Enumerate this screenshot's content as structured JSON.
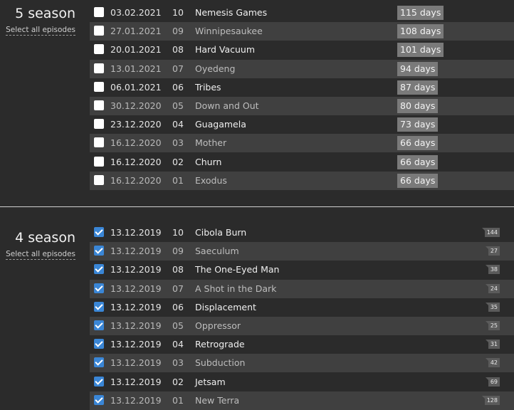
{
  "seasons": [
    {
      "title": "5 season",
      "select_all_label": "Select all episodes",
      "episodes": [
        {
          "checked": false,
          "date": "03.02.2021",
          "num": "10",
          "title": "Nemesis Games",
          "days": "115 days"
        },
        {
          "checked": false,
          "date": "27.01.2021",
          "num": "09",
          "title": "Winnipesaukee",
          "days": "108 days"
        },
        {
          "checked": false,
          "date": "20.01.2021",
          "num": "08",
          "title": "Hard Vacuum",
          "days": "101 days"
        },
        {
          "checked": false,
          "date": "13.01.2021",
          "num": "07",
          "title": "Oyedeng",
          "days": "94 days"
        },
        {
          "checked": false,
          "date": "06.01.2021",
          "num": "06",
          "title": "Tribes",
          "days": "87 days"
        },
        {
          "checked": false,
          "date": "30.12.2020",
          "num": "05",
          "title": "Down and Out",
          "days": "80 days"
        },
        {
          "checked": false,
          "date": "23.12.2020",
          "num": "04",
          "title": "Guagamela",
          "days": "73 days"
        },
        {
          "checked": false,
          "date": "16.12.2020",
          "num": "03",
          "title": "Mother",
          "days": "66 days"
        },
        {
          "checked": false,
          "date": "16.12.2020",
          "num": "02",
          "title": "Churn",
          "days": "66 days"
        },
        {
          "checked": false,
          "date": "16.12.2020",
          "num": "01",
          "title": "Exodus",
          "days": "66 days"
        }
      ]
    },
    {
      "title": "4 season",
      "select_all_label": "Select all episodes",
      "episodes": [
        {
          "checked": true,
          "date": "13.12.2019",
          "num": "10",
          "title": "Cibola Burn",
          "count": "144"
        },
        {
          "checked": true,
          "date": "13.12.2019",
          "num": "09",
          "title": "Saeculum",
          "count": "27"
        },
        {
          "checked": true,
          "date": "13.12.2019",
          "num": "08",
          "title": "The One-Eyed Man",
          "count": "38"
        },
        {
          "checked": true,
          "date": "13.12.2019",
          "num": "07",
          "title": "A Shot in the Dark",
          "count": "24"
        },
        {
          "checked": true,
          "date": "13.12.2019",
          "num": "06",
          "title": "Displacement",
          "count": "35"
        },
        {
          "checked": true,
          "date": "13.12.2019",
          "num": "05",
          "title": "Oppressor",
          "count": "25"
        },
        {
          "checked": true,
          "date": "13.12.2019",
          "num": "04",
          "title": "Retrograde",
          "count": "31"
        },
        {
          "checked": true,
          "date": "13.12.2019",
          "num": "03",
          "title": "Subduction",
          "count": "42"
        },
        {
          "checked": true,
          "date": "13.12.2019",
          "num": "02",
          "title": "Jetsam",
          "count": "69"
        },
        {
          "checked": true,
          "date": "13.12.2019",
          "num": "01",
          "title": "New Terra",
          "count": "128"
        }
      ]
    }
  ],
  "colors": {
    "background": "#2b2b2b",
    "row_alt": "#404040",
    "checkbox_checked": "#3a86d6",
    "days_badge": "#7a7a7a",
    "count_badge": "#5b5b5b"
  }
}
